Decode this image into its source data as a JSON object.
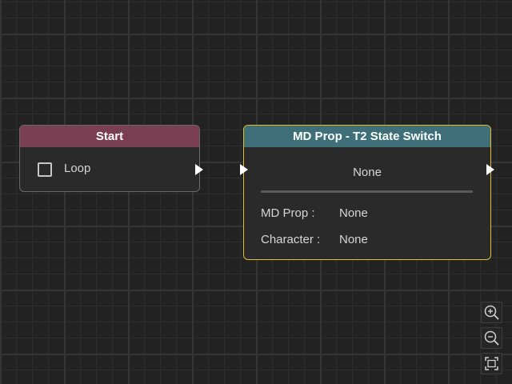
{
  "start_node": {
    "title": "Start",
    "header_color": "#7a3f52",
    "loop_label": "Loop",
    "loop_checked": false
  },
  "md_prop_node": {
    "title": "MD Prop - T2 State Switch",
    "header_color": "#3f6f78",
    "selected_border_color": "#e3c02a",
    "state_value": "None",
    "fields": [
      {
        "label": "MD Prop :",
        "value": "None"
      },
      {
        "label": "Character :",
        "value": "None"
      }
    ]
  },
  "controls": {
    "zoom_in_icon": "zoom-in-icon",
    "zoom_out_icon": "zoom-out-icon",
    "fit_view_icon": "fit-view-icon"
  },
  "colors": {
    "canvas_background": "#222222",
    "port": "#ffffff"
  }
}
